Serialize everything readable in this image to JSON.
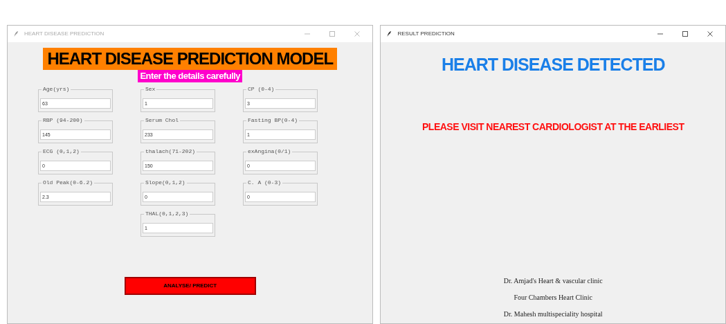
{
  "windows": [
    {
      "title": "HEART DISEASE PREDICTION",
      "active": false,
      "heading": "HEART DISEASE PREDICTION MODEL",
      "subheading": "Enter the details carefully",
      "field_rows": [
        [
          {
            "label": "Age(yrs)",
            "value": "63"
          },
          {
            "label": "Sex",
            "value": "1"
          },
          {
            "label": "CP (0-4)",
            "value": "3"
          }
        ],
        [
          {
            "label": "RBP (94-200)",
            "value": "145"
          },
          {
            "label": "Serum Chol",
            "value": "233"
          },
          {
            "label": "Fasting BP(0-4)",
            "value": "1"
          }
        ],
        [
          {
            "label": "ECG (0,1,2)",
            "value": "0"
          },
          {
            "label": "thalach(71-202)",
            "value": "150"
          },
          {
            "label": "exAngina(0/1)",
            "value": "0"
          }
        ],
        [
          {
            "label": "Old Peak(0-6.2)",
            "value": "2.3"
          },
          {
            "label": "Slope(0,1,2)",
            "value": "0"
          },
          {
            "label": "C. A (0-3)",
            "value": "0"
          }
        ],
        [
          {
            "label": "THAL(0,1,2,3)",
            "value": "1"
          }
        ]
      ],
      "button": "ANALYSE/ PREDICT"
    },
    {
      "title": "RESULT PREDICTION",
      "active": true,
      "result": "HEART DISEASE DETECTED",
      "advice": "PLEASE VISIT NEAREST CARDIOLOGIST AT THE EARLIEST",
      "clinics": [
        "Dr. Amjad's Heart & vascular clinic",
        "Four Chambers Heart Clinic",
        "Dr. Mahesh multispeciality hospital"
      ]
    }
  ]
}
